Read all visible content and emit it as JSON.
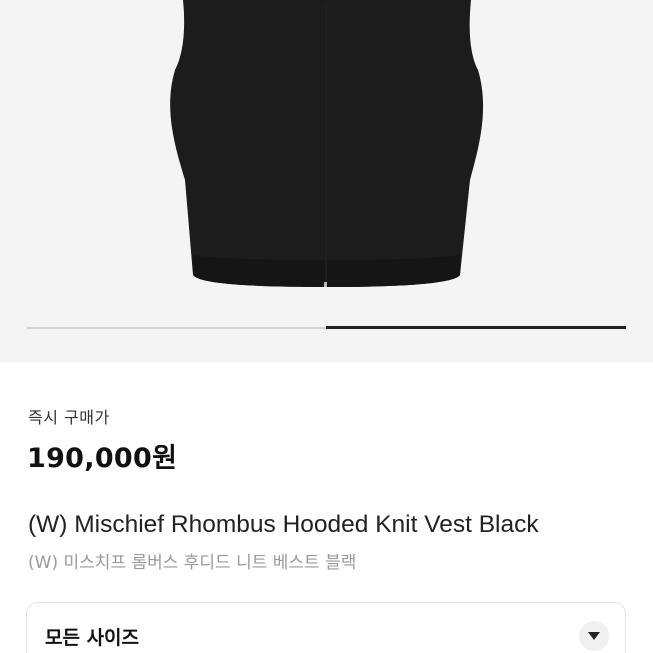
{
  "product": {
    "image_icon": "black-knit-vest-image",
    "gallery": {
      "current": 2,
      "total": 2
    },
    "price_label": "즉시 구매가",
    "price": "190,000원",
    "title_en": "(W) Mischief Rhombus Hooded Knit Vest Black",
    "title_ko": "(W) 미스치프 롬버스 후디드 니트 베스트 블랙"
  },
  "size_selector": {
    "label": "모든 사이즈",
    "icon": "chevron-down-icon"
  },
  "colors": {
    "image_bg": "#f4f4f4",
    "vest": "#1a1a1a",
    "text_primary": "#111111",
    "text_secondary": "#9a9a9a"
  }
}
